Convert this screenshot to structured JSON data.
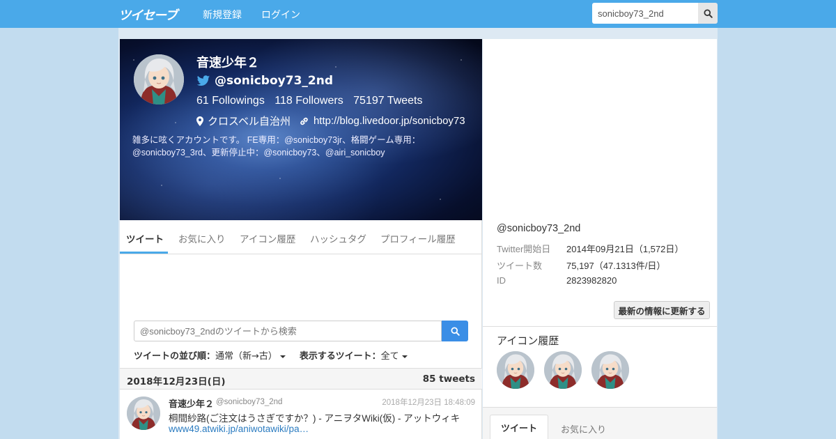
{
  "nav": {
    "logo": "ツイセーブ",
    "register": "新規登録",
    "login": "ログイン",
    "search_value": "sonicboy73_2nd"
  },
  "profile": {
    "name": "音速少年２",
    "handle": "@sonicboy73_2nd",
    "followings": "61 Followings",
    "followers": "118 Followers",
    "tweets": "75197 Tweets",
    "location": "クロスベル自治州",
    "url": "http://blog.livedoor.jp/sonicboy73",
    "bio": "雑多に呟くアカウントです。 FE専用：@sonicboy73jr、格闘ゲーム専用：@sonicboy73_3rd、更新停止中：@sonicboy73、@airi_sonicboy"
  },
  "tabs": [
    "ツイート",
    "お気に入り",
    "アイコン履歴",
    "ハッシュタグ",
    "プロフィール履歴"
  ],
  "search": {
    "placeholder": "@sonicboy73_2ndのツイートから検索"
  },
  "sort": {
    "order_label": "ツイートの並び順：",
    "order_value": "通常（新→古）",
    "filter_label": "表示するツイート：",
    "filter_value": "全て"
  },
  "date_bar": {
    "date": "2018年12月23日(日)",
    "count": "85 tweets"
  },
  "tweet": {
    "name": "音速少年２",
    "handle": "@sonicboy73_2nd",
    "time": "2018年12月23日 18:48:09",
    "text": "桐間紗路(ご注文はうさぎですか？) - アニヲタWiki(仮) - アットウィキ",
    "link": "www49.atwiki.jp/aniwotawiki/pa…"
  },
  "sidebar": {
    "handle": "@sonicboy73_2nd",
    "rows": [
      {
        "key": "Twitter開始日",
        "value": "2014年09月21日（1,572日）"
      },
      {
        "key": "ツイート数",
        "value": "75,197（47.1313件/日）"
      },
      {
        "key": "ID",
        "value": "2823982820"
      }
    ],
    "refresh": "最新の情報に更新する",
    "icon_history_title": "アイコン履歴",
    "tab_active": "ツイート",
    "tab_other": "お気に入り"
  },
  "colors": {
    "nav_bg": "#4aa9e9",
    "page_bg": "#c2dcef",
    "accent": "#3a8ee6",
    "link": "#2a7bc0"
  }
}
